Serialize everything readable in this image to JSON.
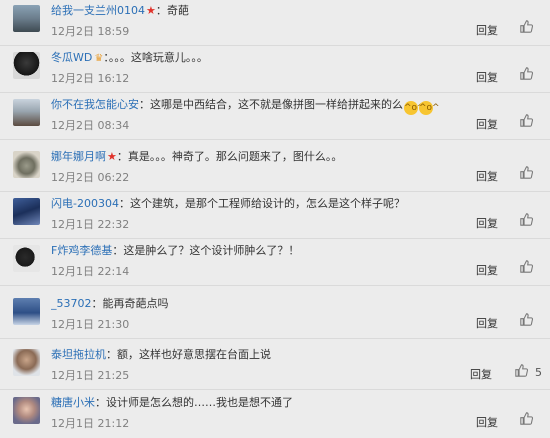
{
  "comments": [
    {
      "user": "给我一支兰州0104",
      "badge": "★",
      "text": "：奇葩",
      "time": "12月2日 18:59",
      "reply": "回复"
    },
    {
      "user": "冬瓜WD",
      "badge": "♛",
      "text": "：。。。这啥玩意儿。。。",
      "time": "12月2日 16:12",
      "reply": "回复"
    },
    {
      "user": "你不在我怎能心安",
      "text": "：这哪是中西结合，这不就是像拼图一样给拼起来的么",
      "time": "12月2日 08:34",
      "reply": "回复"
    },
    {
      "user": "娜年娜月啊",
      "badge": "★",
      "text": "：真是。。。神奇了。那么问题来了，图什么。。",
      "time": "12月2日 06:22",
      "reply": "回复"
    },
    {
      "user": "闪电-200304",
      "text": "：这个建筑，是那个工程师给设计的，怎么是这个样子呢？",
      "time": "12月1日 22:32",
      "reply": "回复"
    },
    {
      "user": "F炸鸡李德基",
      "text": "：这是肿么了？这个设计师肿么了？！",
      "time": "12月1日 22:14",
      "reply": "回复"
    },
    {
      "user": "_53702",
      "text": "：能再奇葩点吗",
      "time": "12月1日 21:30",
      "reply": "回复"
    },
    {
      "user": "泰坦拖拉机",
      "text": "：额，这样也好意思摆在台面上说",
      "time": "12月1日 21:25",
      "reply": "回复",
      "like_count": "5"
    },
    {
      "user": "糖唐小米",
      "text": "：设计师是怎么想的……我也是想不通了",
      "time": "12月1日 21:12",
      "reply": "回复"
    }
  ],
  "icons": {
    "like": "thumbs-up-icon",
    "emoji": "laughing-face-icon"
  },
  "colors": {
    "link": "#2b6fb6",
    "background": "#ececec",
    "badge_star": "#e0322a"
  }
}
